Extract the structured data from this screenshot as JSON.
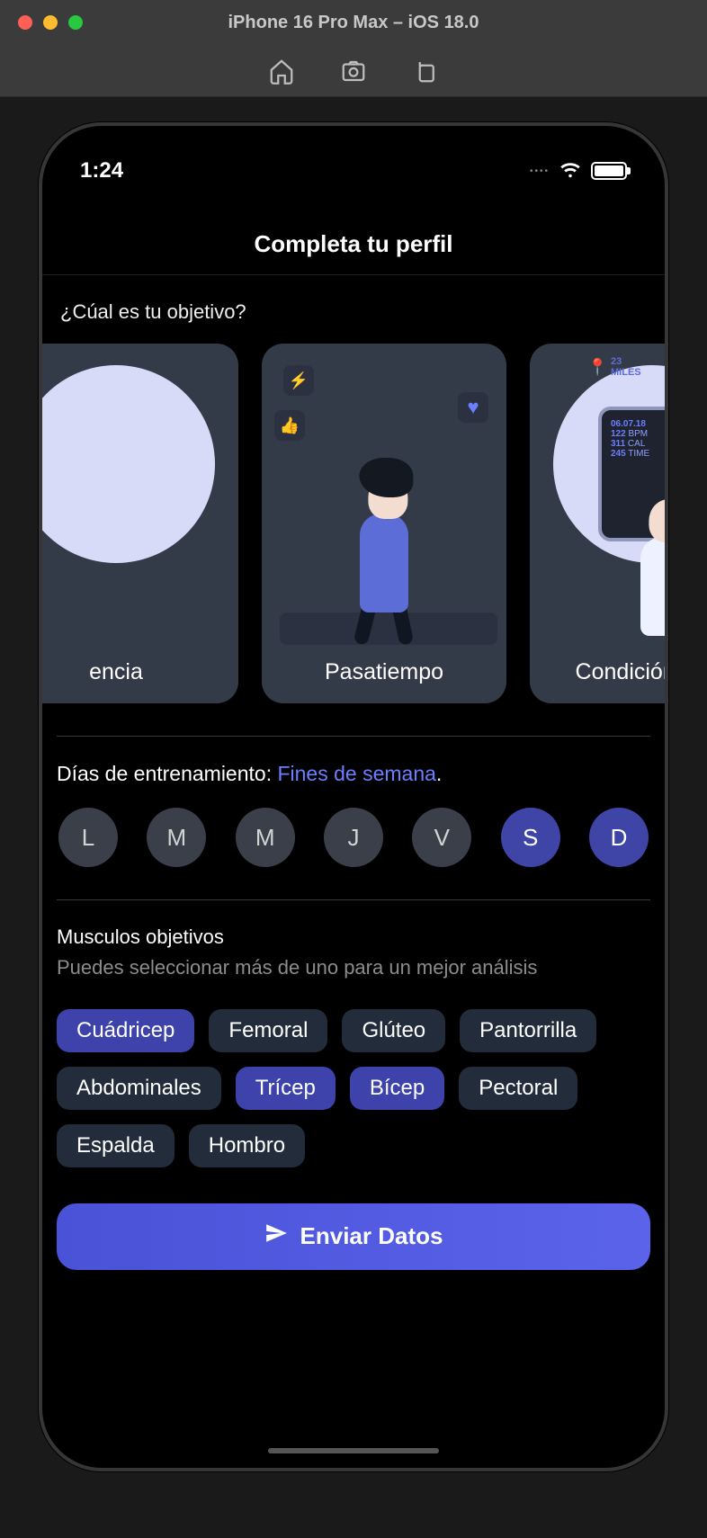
{
  "simulator": {
    "title": "iPhone 16 Pro Max – iOS 18.0"
  },
  "status": {
    "time": "1:24"
  },
  "page": {
    "title": "Completa tu perfil",
    "question": "¿Cúal es tu objetivo?"
  },
  "goals": [
    {
      "label": "encia"
    },
    {
      "label": "Pasatiempo"
    },
    {
      "label": "Condición Físic"
    }
  ],
  "watch": {
    "miles": "23",
    "miles_label": "MILES",
    "date": "06.07.18",
    "bpm_value": "122",
    "bpm_label": "BPM",
    "cal_value": "311",
    "cal_label": "CAL",
    "time_value": "245",
    "time_label": "TIME"
  },
  "training_days": {
    "label_prefix": "Días de entrenamiento: ",
    "accent": "Fines de semana",
    "label_suffix": ".",
    "days": [
      {
        "letter": "L",
        "selected": false
      },
      {
        "letter": "M",
        "selected": false
      },
      {
        "letter": "M",
        "selected": false
      },
      {
        "letter": "J",
        "selected": false
      },
      {
        "letter": "V",
        "selected": false
      },
      {
        "letter": "S",
        "selected": true
      },
      {
        "letter": "D",
        "selected": true
      }
    ]
  },
  "muscles": {
    "title": "Musculos objetivos",
    "subtitle": "Puedes seleccionar más de uno para un mejor análisis",
    "items": [
      {
        "label": "Cuádricep",
        "selected": true
      },
      {
        "label": "Femoral",
        "selected": false
      },
      {
        "label": "Glúteo",
        "selected": false
      },
      {
        "label": "Pantorrilla",
        "selected": false
      },
      {
        "label": "Abdominales",
        "selected": false
      },
      {
        "label": "Trícep",
        "selected": true
      },
      {
        "label": "Bícep",
        "selected": true
      },
      {
        "label": "Pectoral",
        "selected": false
      },
      {
        "label": "Espalda",
        "selected": false
      },
      {
        "label": "Hombro",
        "selected": false
      }
    ]
  },
  "submit": {
    "label": "Enviar Datos"
  },
  "colors": {
    "accent": "#5a63ea",
    "card_bg": "#343b48",
    "chip_bg": "#222c3a",
    "chip_selected": "#3d43aa"
  }
}
